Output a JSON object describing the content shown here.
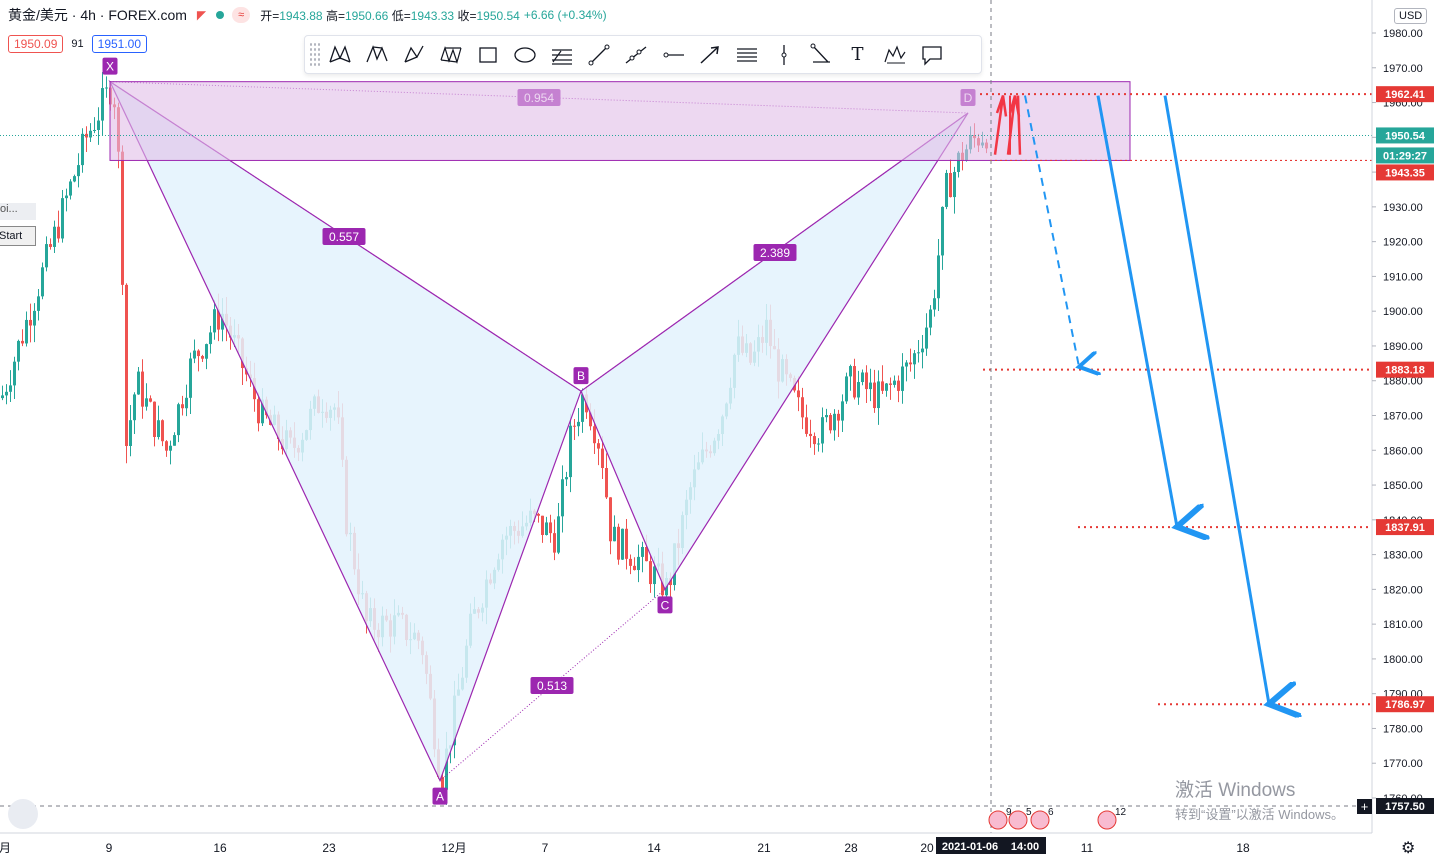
{
  "header": {
    "symbol": "黄金/美元 · 4h · FOREX.com",
    "pill": "≈",
    "open_label": "开=",
    "open": "1943.88",
    "high_label": "高=",
    "high": "1950.66",
    "low_label": "低=",
    "low": "1943.33",
    "close_label": "收=",
    "close": "1950.54",
    "change": "+6.66 (+0.34%)",
    "bid": "1950.09",
    "spread": "91",
    "ask": "1951.00"
  },
  "toolbar": {
    "tools": [
      "xabcd-pattern-icon",
      "cypher-pattern-icon",
      "abcd-pattern-icon",
      "triangle-pattern-icon",
      "rectangle-icon",
      "ellipse-icon",
      "fib-retracement-icon",
      "trend-line-icon",
      "ray-icon",
      "horizontal-ray-icon",
      "arrow-icon",
      "parallel-channel-icon",
      "vertical-line-icon",
      "trend-angle-icon",
      "text-icon",
      "elliott-wave-icon",
      "callout-icon"
    ],
    "text_tool_glyph": "T"
  },
  "currency": "USD",
  "left_widget": {
    "label": "oi...",
    "start": "Start"
  },
  "watermark": {
    "title": "激活 Windows",
    "subtitle": "转到“设置”以激活 Windows。"
  },
  "colors": {
    "up": "#26a69a",
    "down": "#ef5350",
    "pattern": "#9c27b0",
    "fill": "#e3f2fd",
    "zone": "#e1bee7",
    "arrow_blue": "#2196f3",
    "arrow_red": "#f23645"
  },
  "chart_data": {
    "type": "candlestick",
    "symbol": "XAU/USD",
    "interval": "4h",
    "ylim": [
      1756,
      1985
    ],
    "y_ticks": [
      "1980.00",
      "1970.00",
      "1960.00",
      "1950.00",
      "1940.00",
      "1930.00",
      "1920.00",
      "1910.00",
      "1900.00",
      "1890.00",
      "1880.00",
      "1870.00",
      "1860.00",
      "1850.00",
      "1840.00",
      "1830.00",
      "1820.00",
      "1810.00",
      "1800.00",
      "1790.00",
      "1780.00",
      "1770.00",
      "1760.00"
    ],
    "x_ticks": [
      "月",
      "9",
      "16",
      "23",
      "12月",
      "7",
      "14",
      "21",
      "28",
      "20",
      "11",
      "18"
    ],
    "crosshair_date": "2021-01-06",
    "crosshair_time": "14:00",
    "price_labels": {
      "level_1962": "1962.41",
      "last": "1950.54",
      "countdown": "01:29:27",
      "level_1943": "1943.35",
      "level_1883": "1883.18",
      "level_1837": "1837.91",
      "level_1786": "1786.97",
      "crosshair_price": "1757.50"
    },
    "pattern": {
      "points": [
        {
          "label": "X",
          "price": 1966
        },
        {
          "label": "A",
          "price": 1765
        },
        {
          "label": "B",
          "price": 1877
        },
        {
          "label": "C",
          "price": 1820
        },
        {
          "label": "D",
          "price": 1957
        }
      ],
      "ratios": [
        "0.954",
        "0.557",
        "2.389",
        "0.513"
      ]
    },
    "zone": {
      "top": 1966,
      "bottom": 1943.35
    },
    "targets": [
      1883.18,
      1837.91,
      1786.97
    ],
    "events": [
      "9",
      "5",
      "6",
      "12"
    ]
  }
}
